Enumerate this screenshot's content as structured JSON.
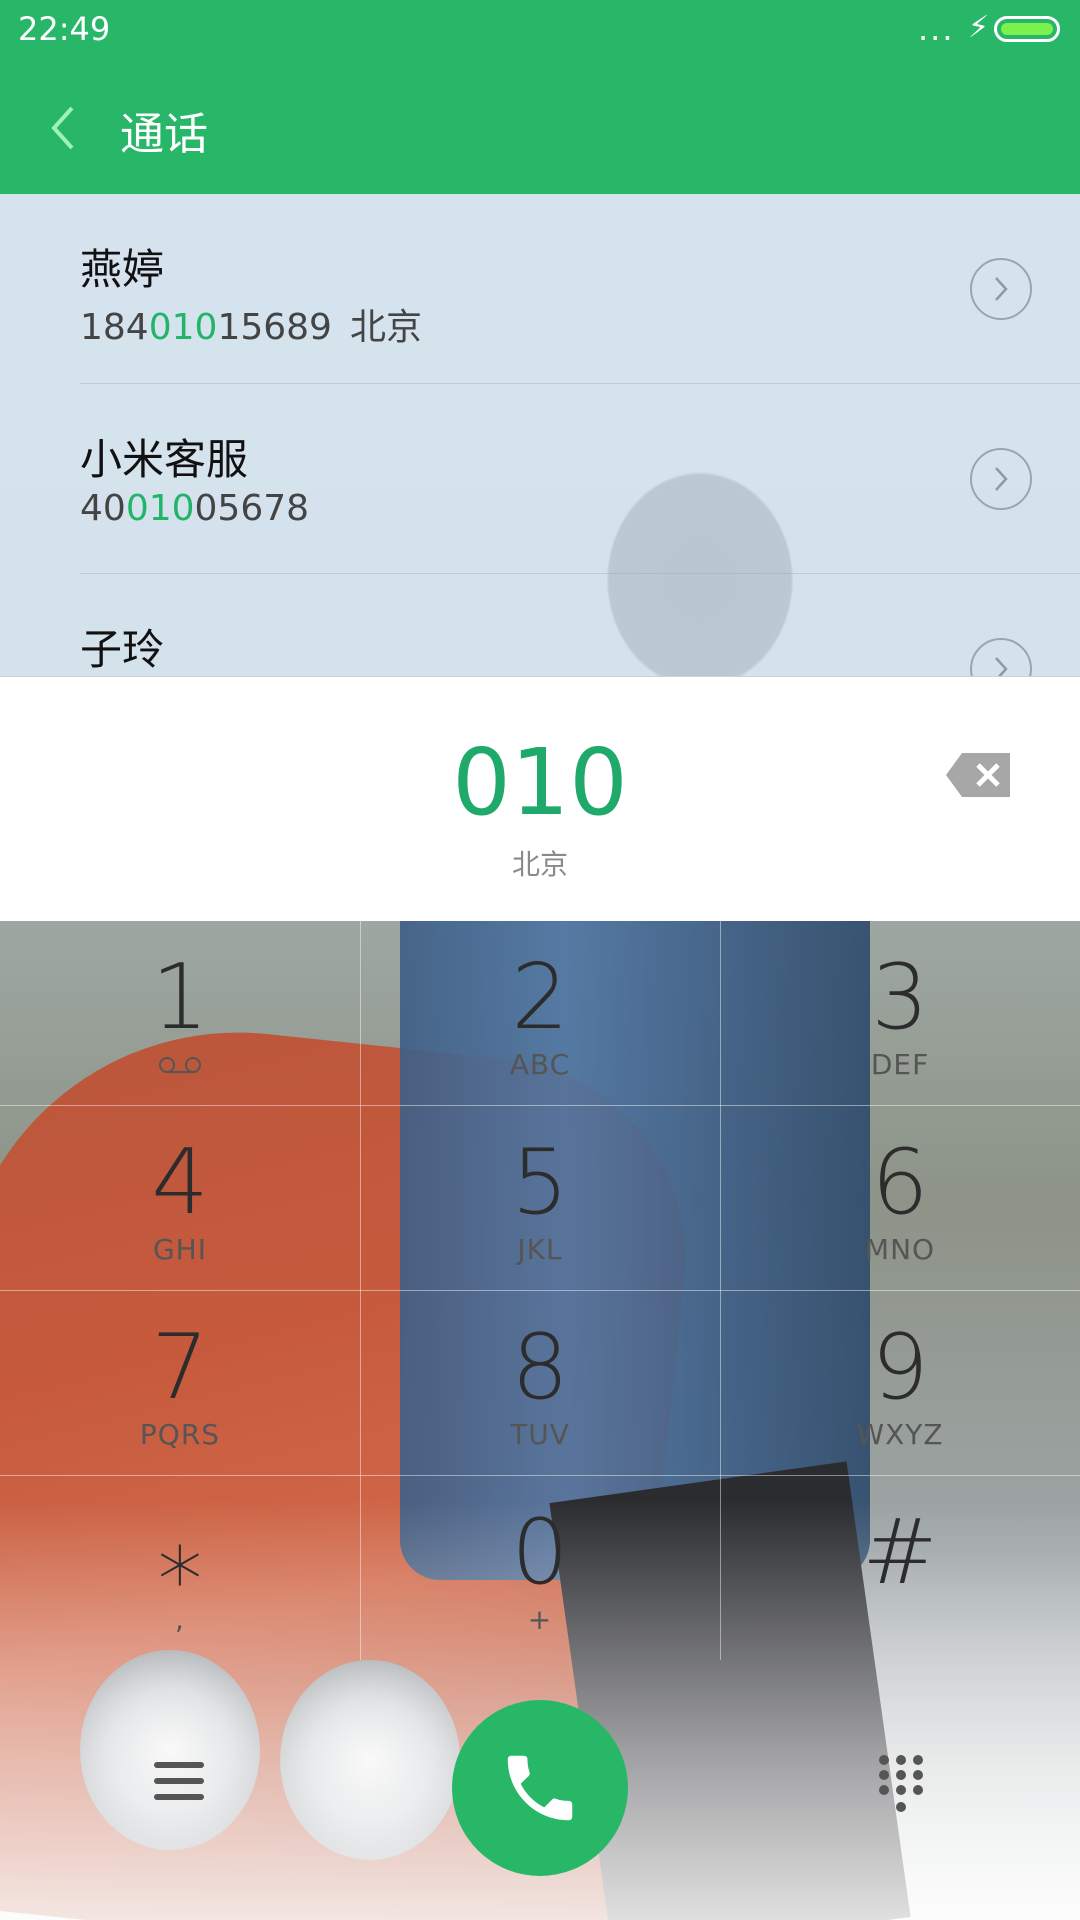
{
  "status_bar": {
    "time": "22:49",
    "signal_dots": "...",
    "charging_icon": "bolt-icon",
    "battery_icon": "battery-icon"
  },
  "header": {
    "title": "通话",
    "back_icon": "back-arrow-icon",
    "bg_color": "#28b768"
  },
  "contacts": [
    {
      "name": "燕婷",
      "number_pre": "184",
      "number_hl": "010",
      "number_post": "15689",
      "location": "北京"
    },
    {
      "name": "小米客服",
      "number_pre": "40",
      "number_hl": "010",
      "number_post": "05678",
      "location": ""
    },
    {
      "name": "子玲",
      "number_pre": "",
      "number_hl": "",
      "number_post": "",
      "location": ""
    }
  ],
  "input": {
    "digits": "010",
    "location": "北京",
    "backspace_icon": "backspace-icon"
  },
  "keypad": [
    {
      "digit": "1",
      "letters": "ꝏ"
    },
    {
      "digit": "2",
      "letters": "ABC"
    },
    {
      "digit": "3",
      "letters": "DEF"
    },
    {
      "digit": "4",
      "letters": "GHI"
    },
    {
      "digit": "5",
      "letters": "JKL"
    },
    {
      "digit": "6",
      "letters": "MNO"
    },
    {
      "digit": "7",
      "letters": "PQRS"
    },
    {
      "digit": "8",
      "letters": "TUV"
    },
    {
      "digit": "9",
      "letters": "WXYZ"
    },
    {
      "digit": "⁎",
      "letters": ","
    },
    {
      "digit": "0",
      "letters": "+"
    },
    {
      "digit": "#",
      "letters": ""
    }
  ],
  "bottom_bar": {
    "menu_icon": "menu-icon",
    "call_icon": "phone-icon",
    "dialpad_icon": "dialpad-icon",
    "accent": "#27b766"
  },
  "colors": {
    "highlight": "#22b56a"
  }
}
